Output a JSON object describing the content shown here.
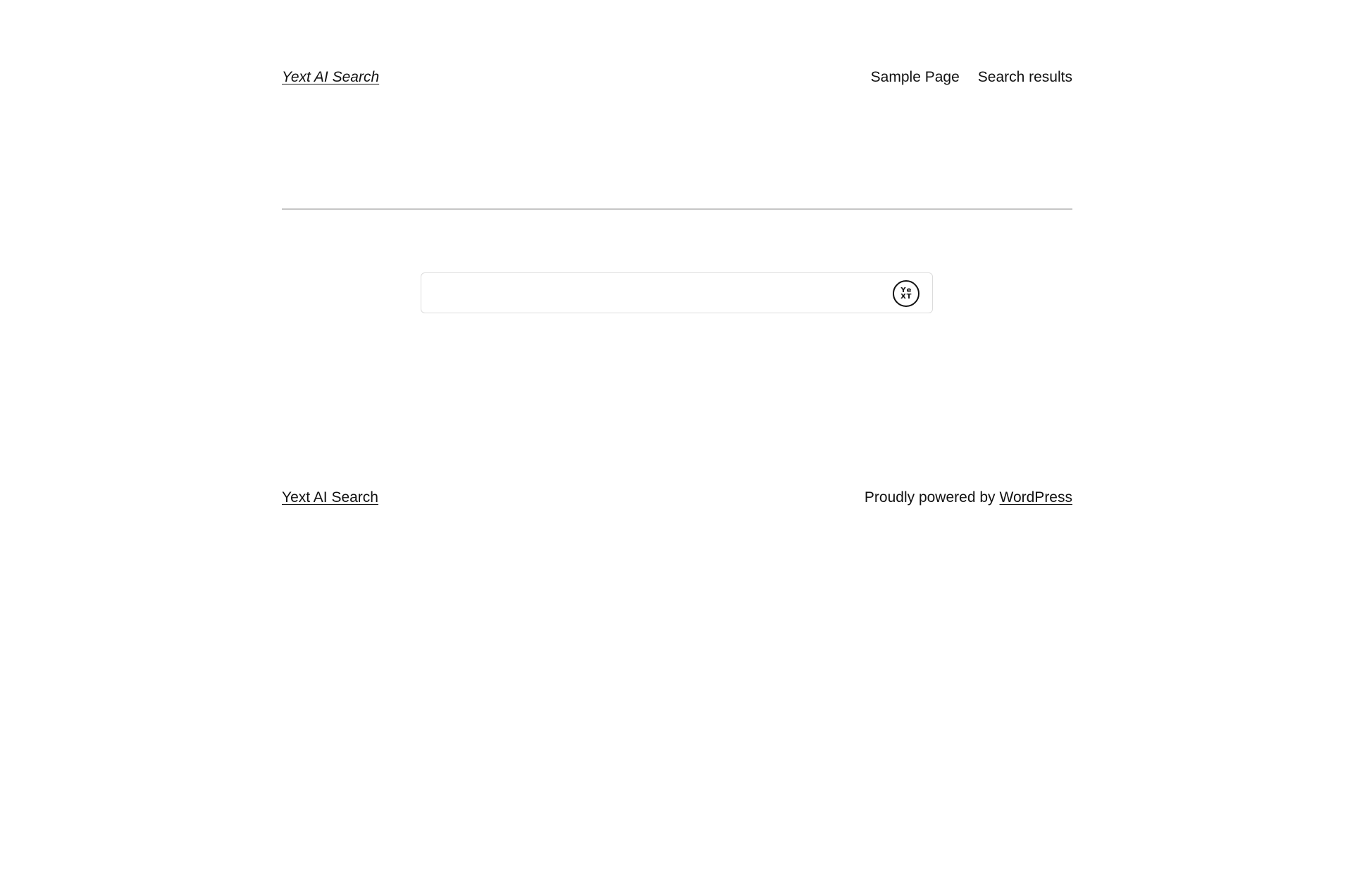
{
  "header": {
    "site_title": "Yext AI Search",
    "nav": [
      {
        "label": "Sample Page"
      },
      {
        "label": "Search results"
      }
    ]
  },
  "search": {
    "value": "",
    "placeholder": "",
    "button_icon": "yext-logo-icon",
    "logo_letters": [
      "Y",
      "e",
      "X",
      "T"
    ]
  },
  "footer": {
    "site_title": "Yext AI Search",
    "powered_text": "Proudly powered by",
    "powered_link": "WordPress"
  },
  "colors": {
    "text": "#111111",
    "divider": "#c6c6c6",
    "search_border": "#dcdcdc",
    "background": "#ffffff"
  }
}
